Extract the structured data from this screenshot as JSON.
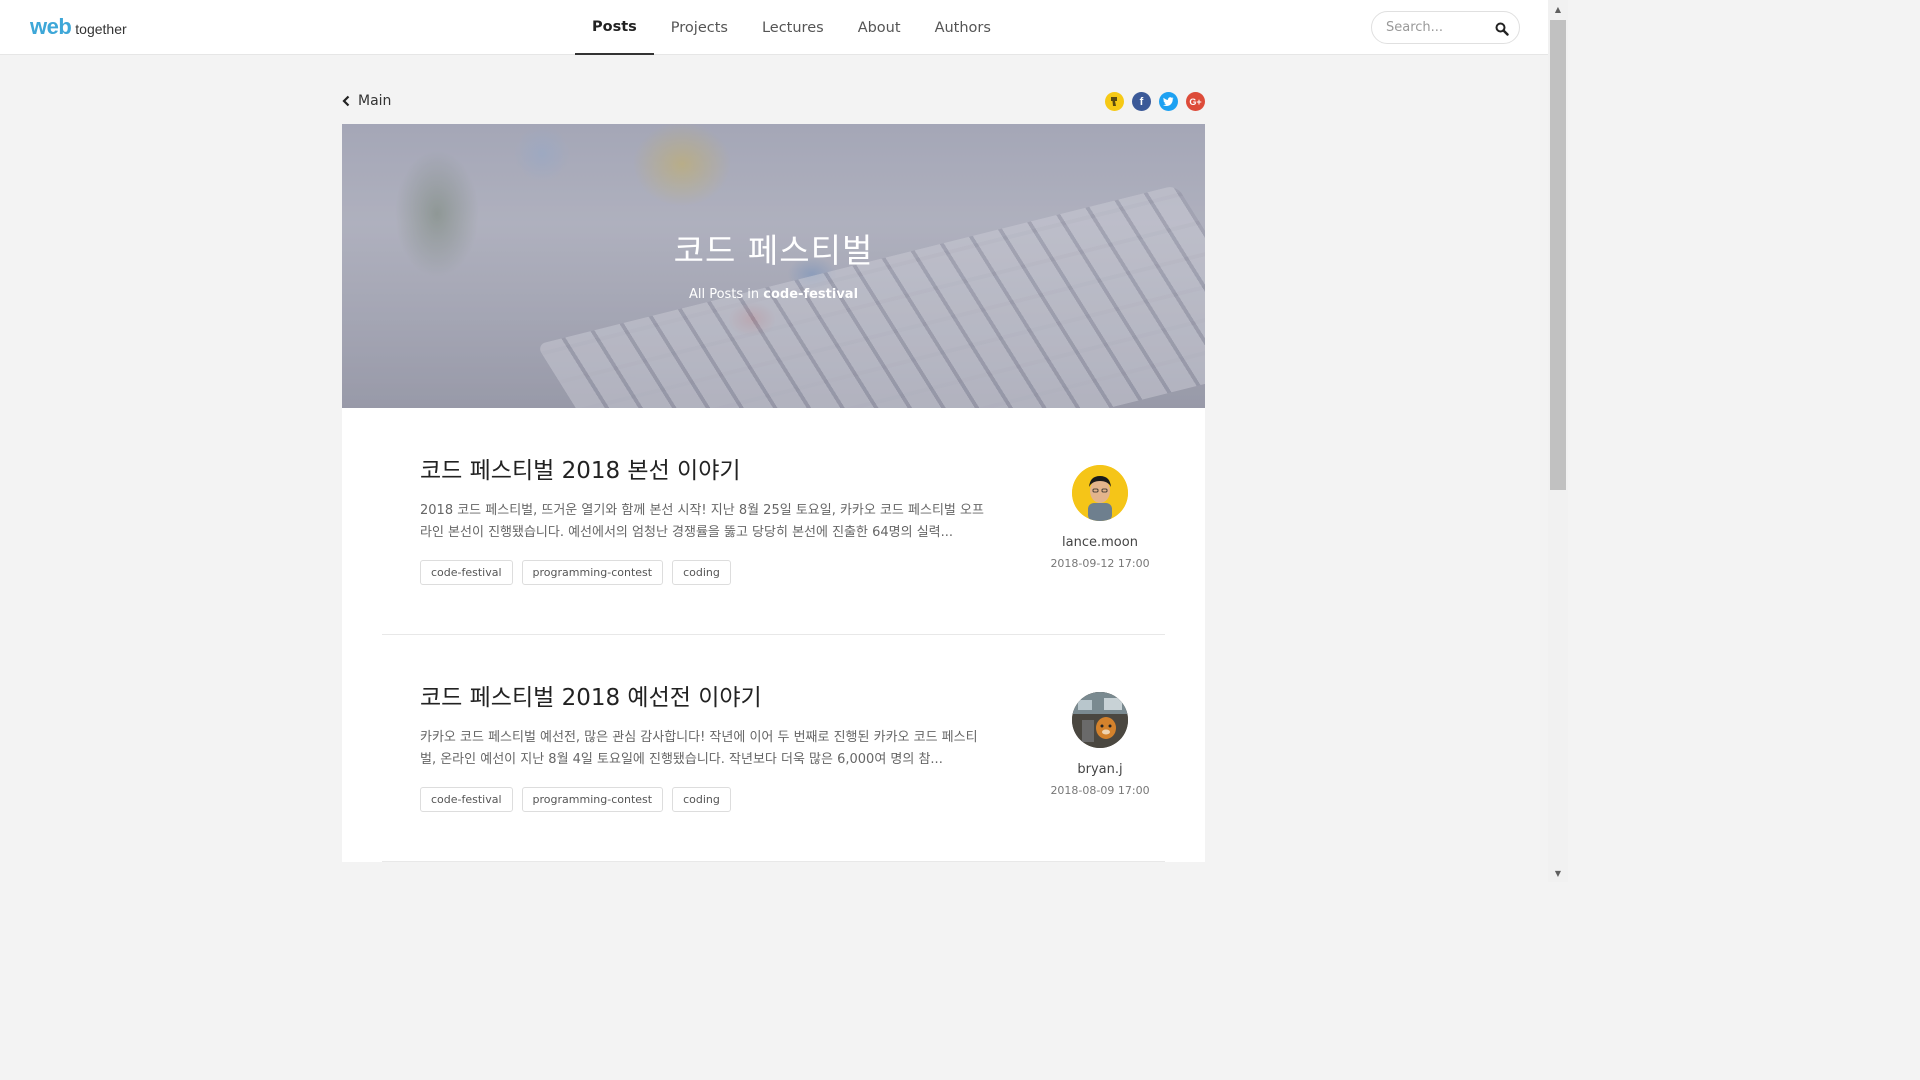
{
  "header": {
    "logo_primary": "web",
    "logo_secondary": "together",
    "nav": [
      {
        "label": "Posts",
        "active": true
      },
      {
        "label": "Projects",
        "active": false
      },
      {
        "label": "Lectures",
        "active": false
      },
      {
        "label": "About",
        "active": false
      },
      {
        "label": "Authors",
        "active": false
      }
    ],
    "search": {
      "placeholder": "Search...",
      "value": "",
      "icon": "search-icon"
    }
  },
  "breadcrumb": {
    "back_label": "Main",
    "icon": "chevron-left-icon"
  },
  "share": [
    {
      "name": "kakaostory",
      "glyph": "",
      "color": "#f6c915"
    },
    {
      "name": "facebook",
      "glyph": "f",
      "color": "#3b5998"
    },
    {
      "name": "twitter",
      "glyph": "",
      "color": "#1da1f2"
    },
    {
      "name": "google-plus",
      "glyph": "G+",
      "color": "#dd4b39"
    }
  ],
  "hero": {
    "title": "코드 페스티벌",
    "subtitle_prefix": "All Posts in ",
    "subtitle_tag": "code-festival"
  },
  "posts": [
    {
      "title": "코드 페스티벌 2018 본선 이야기",
      "excerpt": "2018 코드 페스티벌, 뜨거운 열기와 함께 본선 시작! 지난 8월 25일 토요일, 카카오 코드 페스티벌 오프라인 본선이 진행됐습니다. 예선에서의 엄청난 경쟁률을 뚫고 당당히 본선에 진출한 64명의 실력...",
      "tags": [
        "code-festival",
        "programming-contest",
        "coding"
      ],
      "author": "lance.moon",
      "date": "2018-09-12 17:00"
    },
    {
      "title": "코드 페스티벌 2018 예선전 이야기",
      "excerpt": "카카오 코드 페스티벌 예선전, 많은 관심 감사합니다! 작년에 이어 두 번째로 진행된 카카오 코드 페스티벌, 온라인 예선이 지난 8월 4일 토요일에 진행됐습니다. 작년보다 더욱 많은 6,000여 명의 참...",
      "tags": [
        "code-festival",
        "programming-contest",
        "coding"
      ],
      "author": "bryan.j",
      "date": "2018-08-09 17:00"
    }
  ],
  "colors": {
    "accent": "#3ea7d8",
    "page_bg": "#f3f3f3"
  }
}
